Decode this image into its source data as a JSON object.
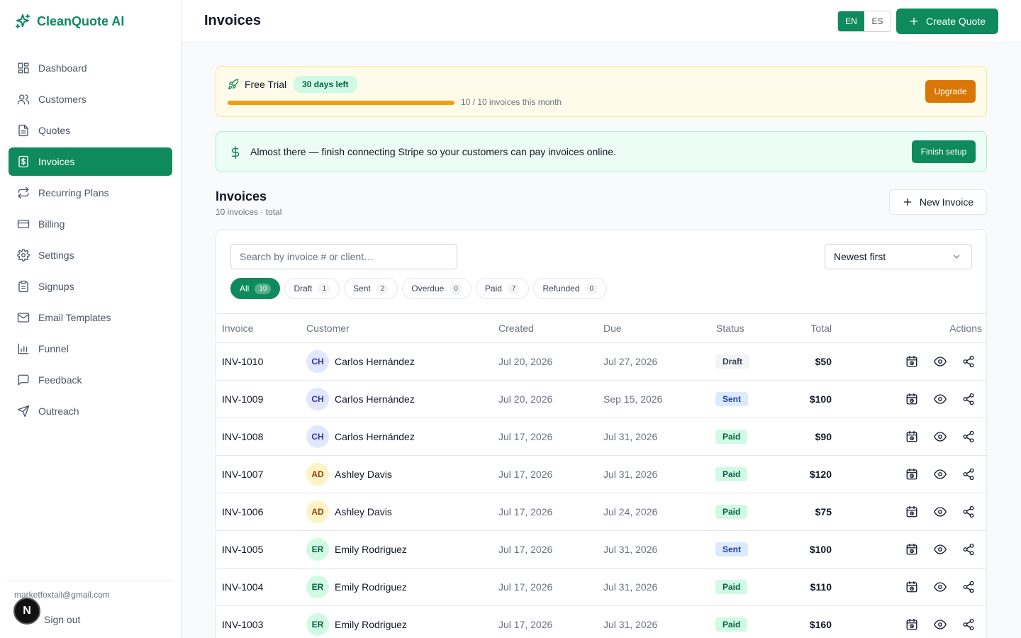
{
  "app": {
    "name": "CleanQuote AI"
  },
  "sidebar": {
    "items": [
      {
        "label": "Dashboard",
        "icon": "dashboard-icon"
      },
      {
        "label": "Customers",
        "icon": "users-icon"
      },
      {
        "label": "Quotes",
        "icon": "document-icon"
      },
      {
        "label": "Invoices",
        "icon": "dollar-file-icon",
        "active": true
      },
      {
        "label": "Recurring Plans",
        "icon": "repeat-icon"
      },
      {
        "label": "Billing",
        "icon": "credit-card-icon"
      },
      {
        "label": "Settings",
        "icon": "gear-icon"
      },
      {
        "label": "Signups",
        "icon": "clipboard-icon"
      },
      {
        "label": "Email Templates",
        "icon": "mail-icon"
      },
      {
        "label": "Funnel",
        "icon": "bar-chart-icon"
      },
      {
        "label": "Feedback",
        "icon": "message-icon"
      },
      {
        "label": "Outreach",
        "icon": "send-icon"
      }
    ],
    "user_email": "marketfoxtail@gmail.com",
    "avatar_letter": "N",
    "sign_out": "Sign out"
  },
  "header": {
    "title": "Invoices",
    "lang_en": "EN",
    "lang_es": "ES",
    "create_quote": "Create Quote"
  },
  "trial": {
    "label": "Free Trial",
    "badge": "30 days left",
    "usage_text": "10 / 10 invoices this month",
    "usage_fraction": 1.0,
    "upgrade": "Upgrade"
  },
  "stripe": {
    "message": "Almost there — finish connecting Stripe so your customers can pay invoices online.",
    "button": "Finish setup"
  },
  "invoices": {
    "title": "Invoices",
    "subtitle": "10 invoices · total",
    "new_button": "New Invoice",
    "search_placeholder": "Search by invoice # or client…",
    "sort": "Newest first",
    "filters": [
      {
        "label": "All",
        "count": "10",
        "active": true
      },
      {
        "label": "Draft",
        "count": "1"
      },
      {
        "label": "Sent",
        "count": "2"
      },
      {
        "label": "Overdue",
        "count": "0"
      },
      {
        "label": "Paid",
        "count": "7"
      },
      {
        "label": "Refunded",
        "count": "0"
      }
    ],
    "columns": {
      "invoice": "Invoice",
      "customer": "Customer",
      "created": "Created",
      "due": "Due",
      "status": "Status",
      "total": "Total",
      "actions": "Actions"
    },
    "rows": [
      {
        "id": "INV-1010",
        "initials": "CH",
        "customer": "Carlos Hernández",
        "created": "Jul 20, 2026",
        "due": "Jul 27, 2026",
        "status": "Draft",
        "total": "$50"
      },
      {
        "id": "INV-1009",
        "initials": "CH",
        "customer": "Carlos Hernández",
        "created": "Jul 20, 2026",
        "due": "Sep 15, 2026",
        "status": "Sent",
        "total": "$100"
      },
      {
        "id": "INV-1008",
        "initials": "CH",
        "customer": "Carlos Hernández",
        "created": "Jul 17, 2026",
        "due": "Jul 31, 2026",
        "status": "Paid",
        "total": "$90"
      },
      {
        "id": "INV-1007",
        "initials": "AD",
        "customer": "Ashley Davis",
        "created": "Jul 17, 2026",
        "due": "Jul 31, 2026",
        "status": "Paid",
        "total": "$120"
      },
      {
        "id": "INV-1006",
        "initials": "AD",
        "customer": "Ashley Davis",
        "created": "Jul 17, 2026",
        "due": "Jul 24, 2026",
        "status": "Paid",
        "total": "$75"
      },
      {
        "id": "INV-1005",
        "initials": "ER",
        "customer": "Emily Rodriguez",
        "created": "Jul 17, 2026",
        "due": "Jul 31, 2026",
        "status": "Sent",
        "total": "$100"
      },
      {
        "id": "INV-1004",
        "initials": "ER",
        "customer": "Emily Rodriguez",
        "created": "Jul 17, 2026",
        "due": "Jul 31, 2026",
        "status": "Paid",
        "total": "$110"
      },
      {
        "id": "INV-1003",
        "initials": "ER",
        "customer": "Emily Rodriguez",
        "created": "Jul 17, 2026",
        "due": "Jul 31, 2026",
        "status": "Paid",
        "total": "$160"
      }
    ]
  },
  "colors": {
    "brand": "#0f8a5f",
    "trial_bar": "#f59e0b",
    "upgrade": "#d97706"
  }
}
